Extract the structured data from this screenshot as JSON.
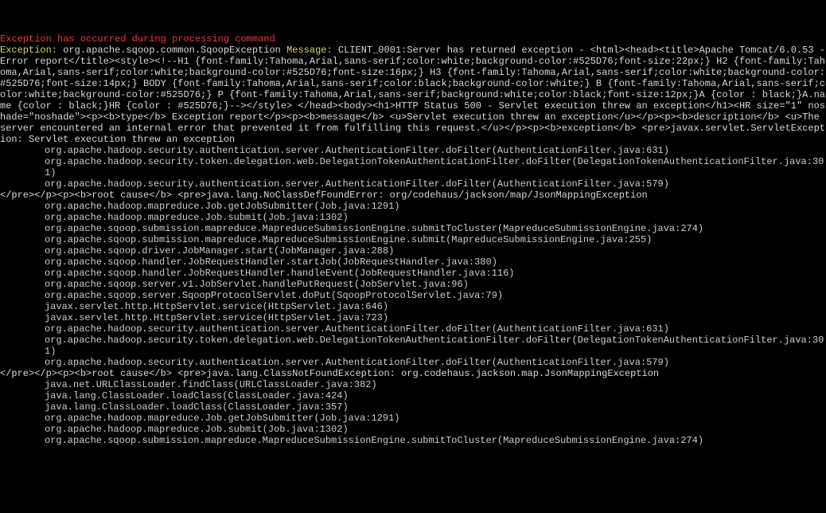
{
  "header": "Exception has occurred during processing command",
  "exception_label": "Exception: ",
  "exception_class": "org.apache.sqoop.common.SqoopException ",
  "message_label": "Message: ",
  "message_body": "CLIENT_0001:Server has returned exception - <html><head><title>Apache Tomcat/6.0.53 - Error report</title><style><!--H1 {font-family:Tahoma,Arial,sans-serif;color:white;background-color:#525D76;font-size:22px;} H2 {font-family:Tahoma,Arial,sans-serif;color:white;background-color:#525D76;font-size:16px;} H3 {font-family:Tahoma,Arial,sans-serif;color:white;background-color:#525D76;font-size:14px;} BODY {font-family:Tahoma,Arial,sans-serif;color:black;background-color:white;} B {font-family:Tahoma,Arial,sans-serif;color:white;background-color:#525D76;} P {font-family:Tahoma,Arial,sans-serif;background:white;color:black;font-size:12px;}A {color : black;}A.name {color : black;}HR {color : #525D76;}--></style> </head><body><h1>HTTP Status 500 - Servlet execution threw an exception</h1><HR size=\"1\" noshade=\"noshade\"><p><b>type</b> Exception report</p><p><b>message</b> <u>Servlet execution threw an exception</u></p><p><b>description</b> <u>The server encountered an internal error that prevented it from fulfilling this request.</u></p><p><b>exception</b> <pre>javax.servlet.ServletException: Servlet execution threw an exception",
  "block1": [
    "org.apache.hadoop.security.authentication.server.AuthenticationFilter.doFilter(AuthenticationFilter.java:631)",
    "org.apache.hadoop.security.token.delegation.web.DelegationTokenAuthenticationFilter.doFilter(DelegationTokenAuthenticationFilter.java:301)",
    "org.apache.hadoop.security.authentication.server.AuthenticationFilter.doFilter(AuthenticationFilter.java:579)"
  ],
  "root_cause_1": "</pre></p><p><b>root cause</b> <pre>java.lang.NoClassDefFoundError: org/codehaus/jackson/map/JsonMappingException",
  "block2": [
    "org.apache.hadoop.mapreduce.Job.getJobSubmitter(Job.java:1291)",
    "org.apache.hadoop.mapreduce.Job.submit(Job.java:1302)",
    "org.apache.sqoop.submission.mapreduce.MapreduceSubmissionEngine.submitToCluster(MapreduceSubmissionEngine.java:274)",
    "org.apache.sqoop.submission.mapreduce.MapreduceSubmissionEngine.submit(MapreduceSubmissionEngine.java:255)",
    "org.apache.sqoop.driver.JobManager.start(JobManager.java:288)",
    "org.apache.sqoop.handler.JobRequestHandler.startJob(JobRequestHandler.java:380)",
    "org.apache.sqoop.handler.JobRequestHandler.handleEvent(JobRequestHandler.java:116)",
    "org.apache.sqoop.server.v1.JobServlet.handlePutRequest(JobServlet.java:96)",
    "org.apache.sqoop.server.SqoopProtocolServlet.doPut(SqoopProtocolServlet.java:79)",
    "javax.servlet.http.HttpServlet.service(HttpServlet.java:646)",
    "javax.servlet.http.HttpServlet.service(HttpServlet.java:723)",
    "org.apache.hadoop.security.authentication.server.AuthenticationFilter.doFilter(AuthenticationFilter.java:631)",
    "org.apache.hadoop.security.token.delegation.web.DelegationTokenAuthenticationFilter.doFilter(DelegationTokenAuthenticationFilter.java:301)",
    "org.apache.hadoop.security.authentication.server.AuthenticationFilter.doFilter(AuthenticationFilter.java:579)"
  ],
  "root_cause_2": "</pre></p><p><b>root cause</b> <pre>java.lang.ClassNotFoundException: org.codehaus.jackson.map.JsonMappingException",
  "block3": [
    "java.net.URLClassLoader.findClass(URLClassLoader.java:382)",
    "java.lang.ClassLoader.loadClass(ClassLoader.java:424)",
    "java.lang.ClassLoader.loadClass(ClassLoader.java:357)",
    "org.apache.hadoop.mapreduce.Job.getJobSubmitter(Job.java:1291)",
    "org.apache.hadoop.mapreduce.Job.submit(Job.java:1302)",
    "org.apache.sqoop.submission.mapreduce.MapreduceSubmissionEngine.submitToCluster(MapreduceSubmissionEngine.java:274)"
  ]
}
